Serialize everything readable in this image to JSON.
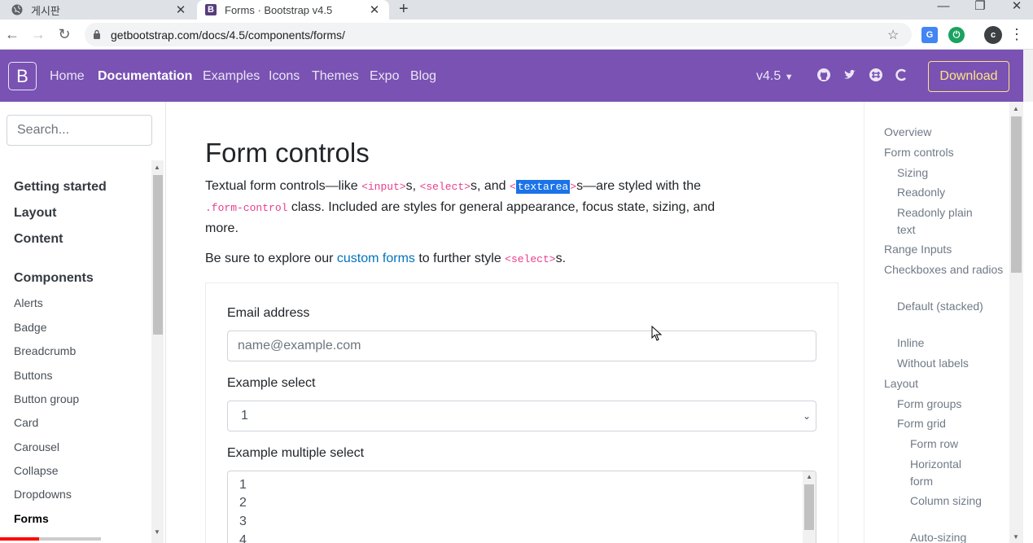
{
  "browser": {
    "tabs": [
      {
        "label": "게시판",
        "icon": "globe-icon",
        "active": false
      },
      {
        "label": "Forms · Bootstrap v4.5",
        "icon": "bootstrap-icon",
        "active": true
      }
    ],
    "url": "getbootstrap.com/docs/4.5/components/forms/",
    "profile_initial": "c"
  },
  "navbar": {
    "logo": "B",
    "links": [
      "Home",
      "Documentation",
      "Examples",
      "Icons",
      "Themes",
      "Expo",
      "Blog"
    ],
    "active_link": "Documentation",
    "version": "v4.5",
    "download_label": "Download",
    "accent_color": "#7952b3",
    "download_color": "#ffe484"
  },
  "sidebar": {
    "search_placeholder": "Search...",
    "groups": [
      "Getting started",
      "Layout",
      "Content",
      "Components"
    ],
    "components": [
      "Alerts",
      "Badge",
      "Breadcrumb",
      "Buttons",
      "Button group",
      "Card",
      "Carousel",
      "Collapse",
      "Dropdowns",
      "Forms"
    ],
    "current": "Forms"
  },
  "main": {
    "title": "Form controls",
    "intro": {
      "t1": "Textual form controls—like ",
      "c1": "<input>",
      "t2": "s, ",
      "c2": "<select>",
      "t3": "s, and ",
      "c3a": "<",
      "c3": "textarea",
      "c3b": ">",
      "t4": "s—are styled with the ",
      "c4": ".form-control",
      "t5": " class. Included are styles for general appearance, focus state, sizing, and more."
    },
    "explore": {
      "t1": "Be sure to explore our ",
      "link": "custom forms",
      "t2": " to further style ",
      "code": "<select>",
      "t3": "s."
    },
    "form": {
      "email_label": "Email address",
      "email_placeholder": "name@example.com",
      "select_label": "Example select",
      "select_value": "1",
      "multi_label": "Example multiple select",
      "multi_options": [
        "1",
        "2",
        "3",
        "4"
      ]
    }
  },
  "toc": {
    "items": [
      {
        "label": "Overview",
        "level": 1
      },
      {
        "label": "Form controls",
        "level": 1
      },
      {
        "label": "Sizing",
        "level": 2
      },
      {
        "label": "Readonly",
        "level": 2
      },
      {
        "label": "Readonly plain text",
        "level": 2
      },
      {
        "label": "Range Inputs",
        "level": 1
      },
      {
        "label": "Checkboxes and radios",
        "level": 1
      },
      {
        "label": "Default (stacked)",
        "level": 2
      },
      {
        "label": "Inline",
        "level": 2
      },
      {
        "label": "Without labels",
        "level": 2
      },
      {
        "label": "Layout",
        "level": 1
      },
      {
        "label": "Form groups",
        "level": 2
      },
      {
        "label": "Form grid",
        "level": 2
      },
      {
        "label": "Form row",
        "level": 3
      },
      {
        "label": "Horizontal form",
        "level": 3
      },
      {
        "label": "Column sizing",
        "level": 3
      },
      {
        "label": "Auto-sizing",
        "level": 3
      }
    ]
  },
  "video_progress": 0.39
}
